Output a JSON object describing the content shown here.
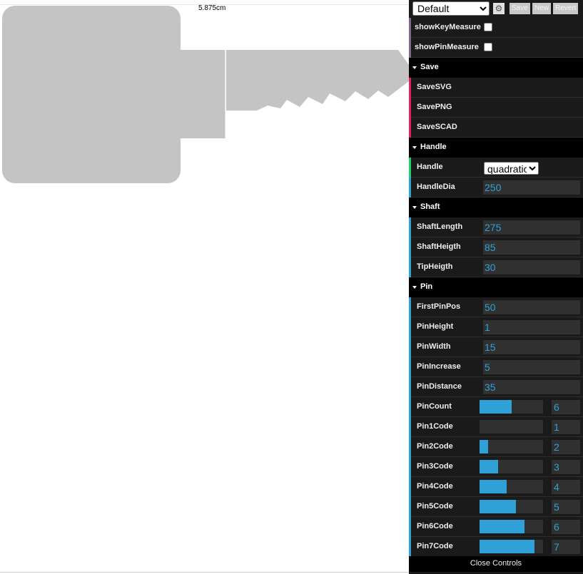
{
  "canvas": {
    "measure_label": "5.875cm"
  },
  "gui": {
    "preset": {
      "selected": "Default",
      "options": [
        "Default"
      ]
    },
    "buttons": {
      "save": "Save",
      "new": "New",
      "revert": "Revert"
    },
    "toggles": [
      {
        "label": "showKeyMeasure",
        "checked": false
      },
      {
        "label": "showPinMeasure",
        "checked": false
      }
    ],
    "save_folder": {
      "title": "Save",
      "items": [
        "SaveSVG",
        "SavePNG",
        "SaveSCAD"
      ]
    },
    "handle_folder": {
      "title": "Handle",
      "handle": {
        "label": "Handle",
        "value": "quadratic",
        "options": [
          "quadratic"
        ]
      },
      "handle_dia": {
        "label": "HandleDia",
        "value": "250"
      }
    },
    "shaft_folder": {
      "title": "Shaft",
      "fields": [
        {
          "label": "ShaftLength",
          "value": "275"
        },
        {
          "label": "ShaftHeigth",
          "value": "85"
        },
        {
          "label": "TipHeigth",
          "value": "30"
        }
      ]
    },
    "pin_folder": {
      "title": "Pin",
      "fields": [
        {
          "label": "FirstPinPos",
          "value": "50"
        },
        {
          "label": "PinHeight",
          "value": "1"
        },
        {
          "label": "PinWidth",
          "value": "15"
        },
        {
          "label": "PinIncrease",
          "value": "5"
        },
        {
          "label": "PinDistance",
          "value": "35"
        }
      ],
      "sliders": [
        {
          "label": "PinCount",
          "value": "6",
          "fill_fraction": 0.5
        },
        {
          "label": "Pin1Code",
          "value": "1",
          "fill_fraction": 0.0
        },
        {
          "label": "Pin2Code",
          "value": "2",
          "fill_fraction": 0.14
        },
        {
          "label": "Pin3Code",
          "value": "3",
          "fill_fraction": 0.29
        },
        {
          "label": "Pin4Code",
          "value": "4",
          "fill_fraction": 0.43
        },
        {
          "label": "Pin5Code",
          "value": "5",
          "fill_fraction": 0.57
        },
        {
          "label": "Pin6Code",
          "value": "6",
          "fill_fraction": 0.71
        },
        {
          "label": "Pin7Code",
          "value": "7",
          "fill_fraction": 0.86
        }
      ]
    },
    "close_label": "Close Controls",
    "colors": {
      "accent": "#2fa1d6",
      "boolean": "#806787",
      "function": "#e61d5f",
      "option": "#1ed36f",
      "number": "#2fa1d6"
    }
  }
}
